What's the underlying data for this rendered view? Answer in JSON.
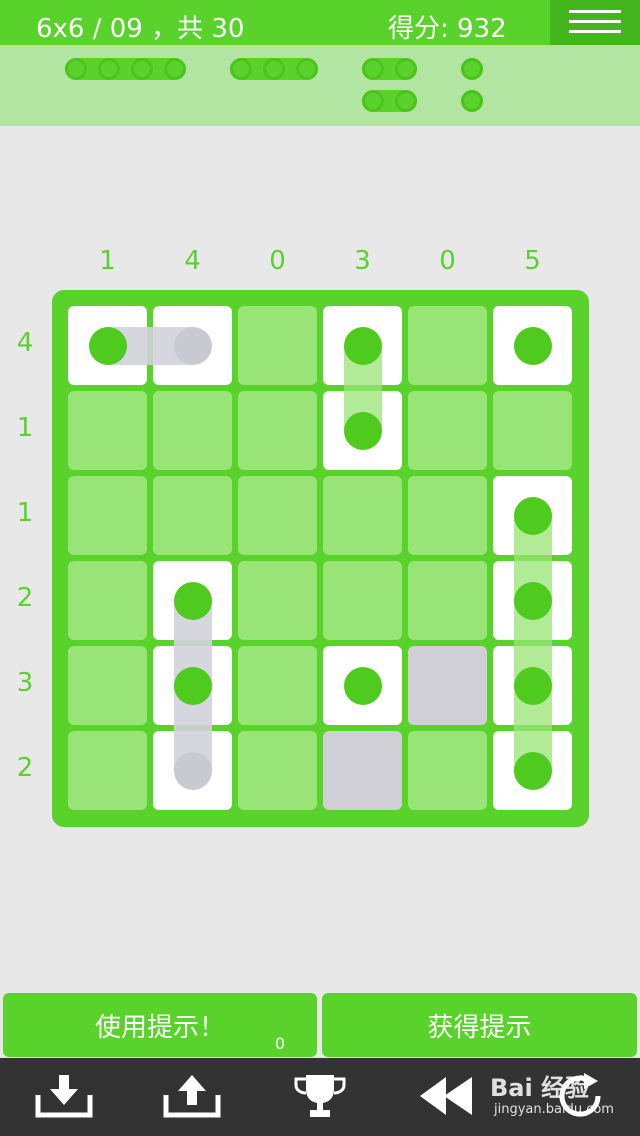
{
  "header": {
    "level": "6x6 / 09 ，共 30",
    "score": "得分: 932"
  },
  "pieces_tray": [
    {
      "length": 4
    },
    {
      "length": 3
    },
    {
      "length": 2
    },
    {
      "length": 2
    },
    {
      "length": 1
    },
    {
      "length": 1
    }
  ],
  "column_clues": [
    "1",
    "4",
    "0",
    "3",
    "0",
    "5"
  ],
  "row_clues": [
    "4",
    "1",
    "1",
    "2",
    "3",
    "2"
  ],
  "grid": [
    [
      "filled",
      "filled",
      "empty",
      "filled",
      "empty",
      "filled"
    ],
    [
      "empty",
      "empty",
      "empty",
      "filled",
      "empty",
      "empty"
    ],
    [
      "empty",
      "empty",
      "empty",
      "empty",
      "empty",
      "filled"
    ],
    [
      "empty",
      "filled",
      "empty",
      "empty",
      "empty",
      "filled"
    ],
    [
      "empty",
      "filled",
      "empty",
      "filled",
      "blocked",
      "filled"
    ],
    [
      "empty",
      "filled",
      "empty",
      "blocked",
      "empty",
      "filled"
    ]
  ],
  "placed_pieces": [
    {
      "cells": [
        [
          0,
          0
        ],
        [
          0,
          1
        ]
      ],
      "end_gray": true
    },
    {
      "cells": [
        [
          0,
          3
        ],
        [
          1,
          3
        ]
      ],
      "end_gray": false
    },
    {
      "cells": [
        [
          0,
          5
        ]
      ],
      "end_gray": false
    },
    {
      "cells": [
        [
          2,
          5
        ],
        [
          3,
          5
        ],
        [
          4,
          5
        ],
        [
          5,
          5
        ]
      ],
      "end_gray": false
    },
    {
      "cells": [
        [
          3,
          1
        ],
        [
          4,
          1
        ],
        [
          5,
          1
        ]
      ],
      "end_gray": true
    },
    {
      "cells": [
        [
          4,
          3
        ]
      ],
      "end_gray": false
    }
  ],
  "buttons": {
    "use_hint": "使用提示！",
    "use_hint_count": "0",
    "get_hint": "获得提示"
  },
  "toolbar": [
    "download-icon",
    "upload-icon",
    "trophy-icon",
    "rewind-icon",
    "restart-icon"
  ],
  "watermark": {
    "title": "Bai 经验",
    "sub": "jingyan.baidu.com"
  },
  "colors": {
    "accent": "#5ad22c",
    "cell_empty": "#98e476",
    "cell_blocked": "#cfcfd5",
    "dot": "#4fca1f"
  }
}
